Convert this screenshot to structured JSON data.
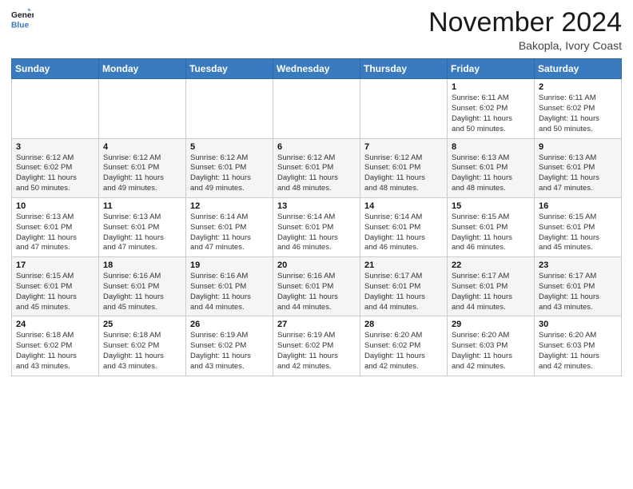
{
  "logo": {
    "line1": "General",
    "line2": "Blue"
  },
  "header": {
    "month": "November 2024",
    "location": "Bakopla, Ivory Coast"
  },
  "weekdays": [
    "Sunday",
    "Monday",
    "Tuesday",
    "Wednesday",
    "Thursday",
    "Friday",
    "Saturday"
  ],
  "weeks": [
    [
      {
        "day": "",
        "info": ""
      },
      {
        "day": "",
        "info": ""
      },
      {
        "day": "",
        "info": ""
      },
      {
        "day": "",
        "info": ""
      },
      {
        "day": "",
        "info": ""
      },
      {
        "day": "1",
        "info": "Sunrise: 6:11 AM\nSunset: 6:02 PM\nDaylight: 11 hours\nand 50 minutes."
      },
      {
        "day": "2",
        "info": "Sunrise: 6:11 AM\nSunset: 6:02 PM\nDaylight: 11 hours\nand 50 minutes."
      }
    ],
    [
      {
        "day": "3",
        "info": "Sunrise: 6:12 AM\nSunset: 6:02 PM\nDaylight: 11 hours\nand 50 minutes."
      },
      {
        "day": "4",
        "info": "Sunrise: 6:12 AM\nSunset: 6:01 PM\nDaylight: 11 hours\nand 49 minutes."
      },
      {
        "day": "5",
        "info": "Sunrise: 6:12 AM\nSunset: 6:01 PM\nDaylight: 11 hours\nand 49 minutes."
      },
      {
        "day": "6",
        "info": "Sunrise: 6:12 AM\nSunset: 6:01 PM\nDaylight: 11 hours\nand 48 minutes."
      },
      {
        "day": "7",
        "info": "Sunrise: 6:12 AM\nSunset: 6:01 PM\nDaylight: 11 hours\nand 48 minutes."
      },
      {
        "day": "8",
        "info": "Sunrise: 6:13 AM\nSunset: 6:01 PM\nDaylight: 11 hours\nand 48 minutes."
      },
      {
        "day": "9",
        "info": "Sunrise: 6:13 AM\nSunset: 6:01 PM\nDaylight: 11 hours\nand 47 minutes."
      }
    ],
    [
      {
        "day": "10",
        "info": "Sunrise: 6:13 AM\nSunset: 6:01 PM\nDaylight: 11 hours\nand 47 minutes."
      },
      {
        "day": "11",
        "info": "Sunrise: 6:13 AM\nSunset: 6:01 PM\nDaylight: 11 hours\nand 47 minutes."
      },
      {
        "day": "12",
        "info": "Sunrise: 6:14 AM\nSunset: 6:01 PM\nDaylight: 11 hours\nand 47 minutes."
      },
      {
        "day": "13",
        "info": "Sunrise: 6:14 AM\nSunset: 6:01 PM\nDaylight: 11 hours\nand 46 minutes."
      },
      {
        "day": "14",
        "info": "Sunrise: 6:14 AM\nSunset: 6:01 PM\nDaylight: 11 hours\nand 46 minutes."
      },
      {
        "day": "15",
        "info": "Sunrise: 6:15 AM\nSunset: 6:01 PM\nDaylight: 11 hours\nand 46 minutes."
      },
      {
        "day": "16",
        "info": "Sunrise: 6:15 AM\nSunset: 6:01 PM\nDaylight: 11 hours\nand 45 minutes."
      }
    ],
    [
      {
        "day": "17",
        "info": "Sunrise: 6:15 AM\nSunset: 6:01 PM\nDaylight: 11 hours\nand 45 minutes."
      },
      {
        "day": "18",
        "info": "Sunrise: 6:16 AM\nSunset: 6:01 PM\nDaylight: 11 hours\nand 45 minutes."
      },
      {
        "day": "19",
        "info": "Sunrise: 6:16 AM\nSunset: 6:01 PM\nDaylight: 11 hours\nand 44 minutes."
      },
      {
        "day": "20",
        "info": "Sunrise: 6:16 AM\nSunset: 6:01 PM\nDaylight: 11 hours\nand 44 minutes."
      },
      {
        "day": "21",
        "info": "Sunrise: 6:17 AM\nSunset: 6:01 PM\nDaylight: 11 hours\nand 44 minutes."
      },
      {
        "day": "22",
        "info": "Sunrise: 6:17 AM\nSunset: 6:01 PM\nDaylight: 11 hours\nand 44 minutes."
      },
      {
        "day": "23",
        "info": "Sunrise: 6:17 AM\nSunset: 6:01 PM\nDaylight: 11 hours\nand 43 minutes."
      }
    ],
    [
      {
        "day": "24",
        "info": "Sunrise: 6:18 AM\nSunset: 6:02 PM\nDaylight: 11 hours\nand 43 minutes."
      },
      {
        "day": "25",
        "info": "Sunrise: 6:18 AM\nSunset: 6:02 PM\nDaylight: 11 hours\nand 43 minutes."
      },
      {
        "day": "26",
        "info": "Sunrise: 6:19 AM\nSunset: 6:02 PM\nDaylight: 11 hours\nand 43 minutes."
      },
      {
        "day": "27",
        "info": "Sunrise: 6:19 AM\nSunset: 6:02 PM\nDaylight: 11 hours\nand 42 minutes."
      },
      {
        "day": "28",
        "info": "Sunrise: 6:20 AM\nSunset: 6:02 PM\nDaylight: 11 hours\nand 42 minutes."
      },
      {
        "day": "29",
        "info": "Sunrise: 6:20 AM\nSunset: 6:03 PM\nDaylight: 11 hours\nand 42 minutes."
      },
      {
        "day": "30",
        "info": "Sunrise: 6:20 AM\nSunset: 6:03 PM\nDaylight: 11 hours\nand 42 minutes."
      }
    ]
  ]
}
